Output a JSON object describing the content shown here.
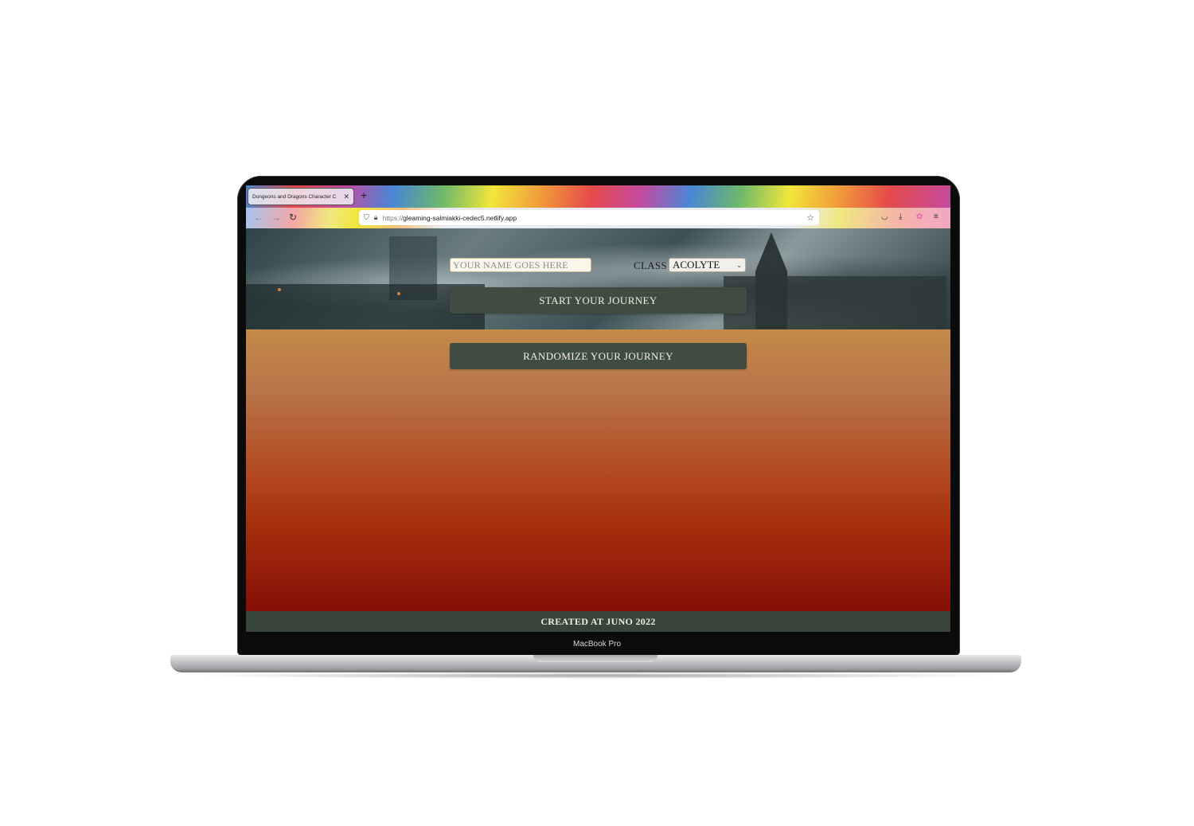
{
  "device": {
    "label": "MacBook Pro"
  },
  "browser": {
    "tab_title": "Dungeons and Dragons Character C",
    "tab_close": "✕",
    "new_tab": "+",
    "url_scheme": "https://",
    "url_host": "gleaming-salmiakki-cedec5.netlify.app"
  },
  "form": {
    "name_placeholder": "YOUR NAME GOES HERE",
    "class_label": "CLASS",
    "class_value": "ACOLYTE",
    "start_button": "START YOUR JOURNEY",
    "randomize_button": "RANDOMIZE YOUR JOURNEY"
  },
  "footer": {
    "text": "CREATED AT JUNO 2022"
  }
}
